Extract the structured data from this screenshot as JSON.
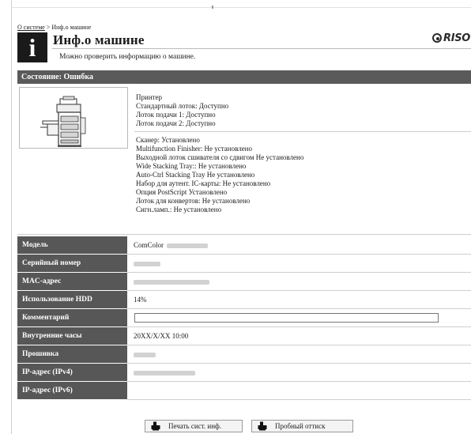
{
  "breadcrumb": {
    "root": "О системе",
    "separator": ">",
    "current": "Инф.о машине"
  },
  "header": {
    "title": "Инф.о машине",
    "subtitle": "Можно проверить информацию о машине.",
    "logo_text": "RISO"
  },
  "status": {
    "label": "Состояние: Ошибка",
    "printer_lines": [
      "Принтер",
      "Стандартный лоток: Доступно",
      "Лоток подачи 1: Доступно",
      "Лоток подачи 2: Доступно"
    ],
    "option_lines": [
      "Сканер: Установлено",
      "Multifunction Finisher: Не установлено",
      "Выходной лоток сшивателя со сдвигом Не установлено",
      "Wide Stacking Tray:: Не установлено",
      "Auto-Ctrl Stacking Tray Не установлено",
      "Набор для аутент. IC-карты: Не установлено",
      "Опция PostScript Установлено",
      "Лоток для конвертов: Не установлено",
      "Сигн.ламп.: Не установлено"
    ]
  },
  "info": {
    "model_label": "Модель",
    "model_value": "ComColor",
    "serial_label": "Серийный номер",
    "mac_label": "MAC-адрес",
    "hdd_label": "Использование HDD",
    "hdd_value": "14%",
    "hdd_fraction": 0.14,
    "comment_label": "Комментарий",
    "comment_value": "",
    "clock_label": "Внутренние часы",
    "clock_value": "20XX/X/XX 10:00",
    "firmware_label": "Прошивка",
    "ipv4_label": "IP-адрес (IPv4)",
    "ipv6_label": "IP-адрес (IPv6)"
  },
  "buttons": {
    "print_info": "Печать сист. инф.",
    "test_print": "Пробный оттиск"
  },
  "icons": {
    "info": "info-icon",
    "printer": "printer-icon"
  },
  "colors": {
    "header_bar": "#5a5a5a",
    "label_bg": "#575757"
  }
}
